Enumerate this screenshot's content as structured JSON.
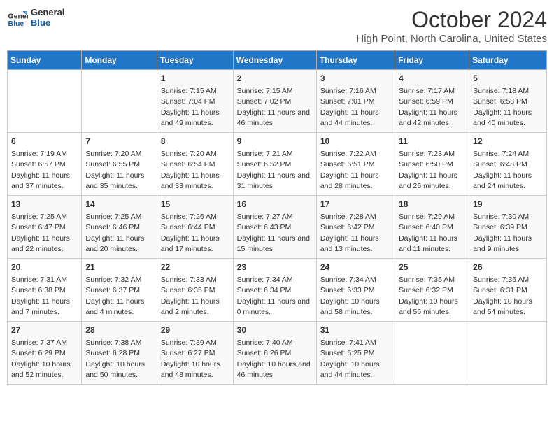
{
  "logo": {
    "general": "General",
    "blue": "Blue"
  },
  "title": "October 2024",
  "subtitle": "High Point, North Carolina, United States",
  "days_of_week": [
    "Sunday",
    "Monday",
    "Tuesday",
    "Wednesday",
    "Thursday",
    "Friday",
    "Saturday"
  ],
  "weeks": [
    [
      {
        "day": "",
        "sunrise": "",
        "sunset": "",
        "daylight": ""
      },
      {
        "day": "",
        "sunrise": "",
        "sunset": "",
        "daylight": ""
      },
      {
        "day": "1",
        "sunrise": "Sunrise: 7:15 AM",
        "sunset": "Sunset: 7:04 PM",
        "daylight": "Daylight: 11 hours and 49 minutes."
      },
      {
        "day": "2",
        "sunrise": "Sunrise: 7:15 AM",
        "sunset": "Sunset: 7:02 PM",
        "daylight": "Daylight: 11 hours and 46 minutes."
      },
      {
        "day": "3",
        "sunrise": "Sunrise: 7:16 AM",
        "sunset": "Sunset: 7:01 PM",
        "daylight": "Daylight: 11 hours and 44 minutes."
      },
      {
        "day": "4",
        "sunrise": "Sunrise: 7:17 AM",
        "sunset": "Sunset: 6:59 PM",
        "daylight": "Daylight: 11 hours and 42 minutes."
      },
      {
        "day": "5",
        "sunrise": "Sunrise: 7:18 AM",
        "sunset": "Sunset: 6:58 PM",
        "daylight": "Daylight: 11 hours and 40 minutes."
      }
    ],
    [
      {
        "day": "6",
        "sunrise": "Sunrise: 7:19 AM",
        "sunset": "Sunset: 6:57 PM",
        "daylight": "Daylight: 11 hours and 37 minutes."
      },
      {
        "day": "7",
        "sunrise": "Sunrise: 7:20 AM",
        "sunset": "Sunset: 6:55 PM",
        "daylight": "Daylight: 11 hours and 35 minutes."
      },
      {
        "day": "8",
        "sunrise": "Sunrise: 7:20 AM",
        "sunset": "Sunset: 6:54 PM",
        "daylight": "Daylight: 11 hours and 33 minutes."
      },
      {
        "day": "9",
        "sunrise": "Sunrise: 7:21 AM",
        "sunset": "Sunset: 6:52 PM",
        "daylight": "Daylight: 11 hours and 31 minutes."
      },
      {
        "day": "10",
        "sunrise": "Sunrise: 7:22 AM",
        "sunset": "Sunset: 6:51 PM",
        "daylight": "Daylight: 11 hours and 28 minutes."
      },
      {
        "day": "11",
        "sunrise": "Sunrise: 7:23 AM",
        "sunset": "Sunset: 6:50 PM",
        "daylight": "Daylight: 11 hours and 26 minutes."
      },
      {
        "day": "12",
        "sunrise": "Sunrise: 7:24 AM",
        "sunset": "Sunset: 6:48 PM",
        "daylight": "Daylight: 11 hours and 24 minutes."
      }
    ],
    [
      {
        "day": "13",
        "sunrise": "Sunrise: 7:25 AM",
        "sunset": "Sunset: 6:47 PM",
        "daylight": "Daylight: 11 hours and 22 minutes."
      },
      {
        "day": "14",
        "sunrise": "Sunrise: 7:25 AM",
        "sunset": "Sunset: 6:46 PM",
        "daylight": "Daylight: 11 hours and 20 minutes."
      },
      {
        "day": "15",
        "sunrise": "Sunrise: 7:26 AM",
        "sunset": "Sunset: 6:44 PM",
        "daylight": "Daylight: 11 hours and 17 minutes."
      },
      {
        "day": "16",
        "sunrise": "Sunrise: 7:27 AM",
        "sunset": "Sunset: 6:43 PM",
        "daylight": "Daylight: 11 hours and 15 minutes."
      },
      {
        "day": "17",
        "sunrise": "Sunrise: 7:28 AM",
        "sunset": "Sunset: 6:42 PM",
        "daylight": "Daylight: 11 hours and 13 minutes."
      },
      {
        "day": "18",
        "sunrise": "Sunrise: 7:29 AM",
        "sunset": "Sunset: 6:40 PM",
        "daylight": "Daylight: 11 hours and 11 minutes."
      },
      {
        "day": "19",
        "sunrise": "Sunrise: 7:30 AM",
        "sunset": "Sunset: 6:39 PM",
        "daylight": "Daylight: 11 hours and 9 minutes."
      }
    ],
    [
      {
        "day": "20",
        "sunrise": "Sunrise: 7:31 AM",
        "sunset": "Sunset: 6:38 PM",
        "daylight": "Daylight: 11 hours and 7 minutes."
      },
      {
        "day": "21",
        "sunrise": "Sunrise: 7:32 AM",
        "sunset": "Sunset: 6:37 PM",
        "daylight": "Daylight: 11 hours and 4 minutes."
      },
      {
        "day": "22",
        "sunrise": "Sunrise: 7:33 AM",
        "sunset": "Sunset: 6:35 PM",
        "daylight": "Daylight: 11 hours and 2 minutes."
      },
      {
        "day": "23",
        "sunrise": "Sunrise: 7:34 AM",
        "sunset": "Sunset: 6:34 PM",
        "daylight": "Daylight: 11 hours and 0 minutes."
      },
      {
        "day": "24",
        "sunrise": "Sunrise: 7:34 AM",
        "sunset": "Sunset: 6:33 PM",
        "daylight": "Daylight: 10 hours and 58 minutes."
      },
      {
        "day": "25",
        "sunrise": "Sunrise: 7:35 AM",
        "sunset": "Sunset: 6:32 PM",
        "daylight": "Daylight: 10 hours and 56 minutes."
      },
      {
        "day": "26",
        "sunrise": "Sunrise: 7:36 AM",
        "sunset": "Sunset: 6:31 PM",
        "daylight": "Daylight: 10 hours and 54 minutes."
      }
    ],
    [
      {
        "day": "27",
        "sunrise": "Sunrise: 7:37 AM",
        "sunset": "Sunset: 6:29 PM",
        "daylight": "Daylight: 10 hours and 52 minutes."
      },
      {
        "day": "28",
        "sunrise": "Sunrise: 7:38 AM",
        "sunset": "Sunset: 6:28 PM",
        "daylight": "Daylight: 10 hours and 50 minutes."
      },
      {
        "day": "29",
        "sunrise": "Sunrise: 7:39 AM",
        "sunset": "Sunset: 6:27 PM",
        "daylight": "Daylight: 10 hours and 48 minutes."
      },
      {
        "day": "30",
        "sunrise": "Sunrise: 7:40 AM",
        "sunset": "Sunset: 6:26 PM",
        "daylight": "Daylight: 10 hours and 46 minutes."
      },
      {
        "day": "31",
        "sunrise": "Sunrise: 7:41 AM",
        "sunset": "Sunset: 6:25 PM",
        "daylight": "Daylight: 10 hours and 44 minutes."
      },
      {
        "day": "",
        "sunrise": "",
        "sunset": "",
        "daylight": ""
      },
      {
        "day": "",
        "sunrise": "",
        "sunset": "",
        "daylight": ""
      }
    ]
  ]
}
